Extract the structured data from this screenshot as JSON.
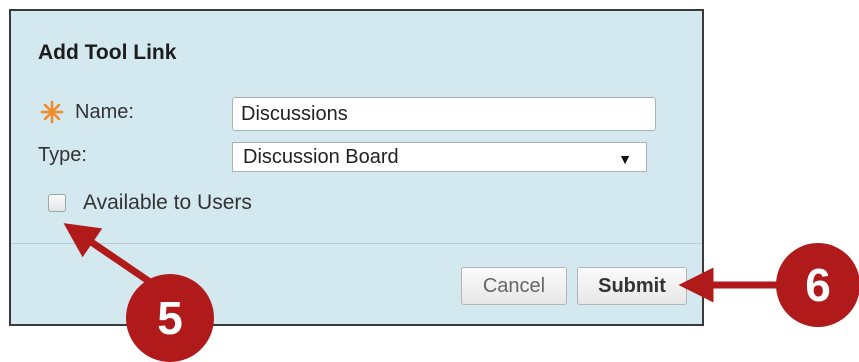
{
  "dialog": {
    "title": "Add Tool Link",
    "name_label": "Name:",
    "name_value": "Discussions",
    "type_label": "Type:",
    "type_selected": "Discussion Board",
    "available_label": "Available to Users",
    "available_checked": false,
    "cancel_label": "Cancel",
    "submit_label": "Submit"
  },
  "callouts": {
    "step5": "5",
    "step6": "6"
  },
  "colors": {
    "dialog_bg": "#d3e8ef",
    "required_asterisk": "#f08c28",
    "callout_red": "#b01a1a"
  },
  "icons": {
    "required": "asterisk-icon",
    "select": "dropdown-triangle-icon"
  }
}
